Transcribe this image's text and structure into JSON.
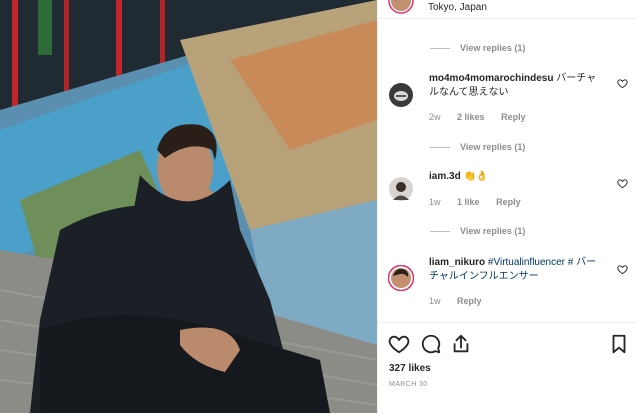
{
  "post": {
    "location": "Tokyo, Japan",
    "likes": "327 likes",
    "date": "MARCH 30"
  },
  "view_replies": [
    {
      "label": "View replies (1)"
    },
    {
      "label": "View replies (1)"
    },
    {
      "label": "View replies (1)"
    }
  ],
  "comments": [
    {
      "username": "mo4mo4momarochindesu",
      "text": "バーチャルなんて思えない",
      "age": "2w",
      "likes": "2 likes",
      "reply": "Reply"
    },
    {
      "username": "iam.3d",
      "text": "👏👌",
      "age": "1w",
      "likes": "1 like",
      "reply": "Reply"
    },
    {
      "username": "liam_nikuro",
      "hashtag": "#Virtualinfluencer",
      "text": "# バーチャルインフルエンサー",
      "age": "1w",
      "reply": "Reply"
    }
  ],
  "icons": {
    "like": "heart-outline-icon",
    "comment": "comment-bubble-icon",
    "share": "share-icon",
    "save": "bookmark-icon"
  },
  "colors": {
    "link": "#003569",
    "muted": "#8e8e8e",
    "text": "#262626",
    "border": "#efefef"
  }
}
